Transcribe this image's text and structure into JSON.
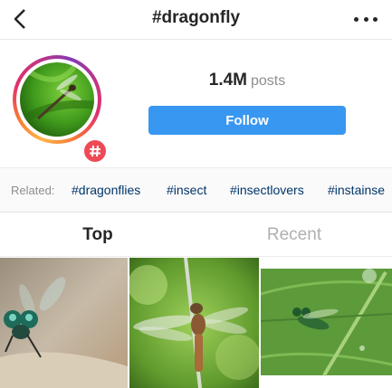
{
  "header": {
    "back_icon": "chevron-left-icon",
    "title": "#dragonfly",
    "more_icon": "more-horizontal-icon"
  },
  "profile": {
    "post_count": "1.4M",
    "post_count_label": "posts",
    "follow_label": "Follow",
    "badge_symbol": "#",
    "badge_color": "#ed4956"
  },
  "related": {
    "label": "Related:",
    "tags": [
      "#dragonflies",
      "#insect",
      "#insectlovers",
      "#instainse"
    ]
  },
  "tabs": {
    "top_label": "Top",
    "recent_label": "Recent"
  },
  "colors": {
    "accent": "#3897f0",
    "link": "#003569",
    "muted": "#8e8e8e"
  }
}
